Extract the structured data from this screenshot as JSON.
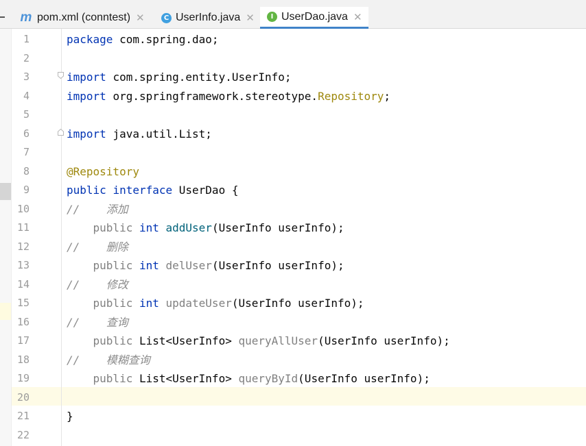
{
  "tabs": [
    {
      "label": "pom.xml (conntest)",
      "icon": "maven-icon",
      "icon_glyph": "m",
      "active": false
    },
    {
      "label": "UserInfo.java",
      "icon": "class-icon",
      "icon_glyph": "C",
      "active": false
    },
    {
      "label": "UserDao.java",
      "icon": "interface-icon",
      "icon_glyph": "I",
      "active": true
    }
  ],
  "close_glyph": "✕",
  "current_line": 20,
  "lines": [
    {
      "n": "1",
      "tokens": [
        {
          "t": "package ",
          "c": "kw"
        },
        {
          "t": "com.spring.dao;",
          "c": ""
        }
      ]
    },
    {
      "n": "2",
      "tokens": []
    },
    {
      "n": "3",
      "tokens": [
        {
          "t": "import ",
          "c": "kw"
        },
        {
          "t": "com.spring.entity.UserInfo;",
          "c": ""
        }
      ]
    },
    {
      "n": "4",
      "tokens": [
        {
          "t": "import ",
          "c": "kw"
        },
        {
          "t": "org.springframework.stereotype.",
          "c": ""
        },
        {
          "t": "Repository",
          "c": "type"
        },
        {
          "t": ";",
          "c": ""
        }
      ]
    },
    {
      "n": "5",
      "tokens": []
    },
    {
      "n": "6",
      "tokens": [
        {
          "t": "import ",
          "c": "kw"
        },
        {
          "t": "java.util.List;",
          "c": ""
        }
      ]
    },
    {
      "n": "7",
      "tokens": []
    },
    {
      "n": "8",
      "tokens": [
        {
          "t": "@Repository",
          "c": "ann"
        }
      ]
    },
    {
      "n": "9",
      "tokens": [
        {
          "t": "public ",
          "c": "kw"
        },
        {
          "t": "interface ",
          "c": "kw"
        },
        {
          "t": "UserDao {",
          "c": ""
        }
      ]
    },
    {
      "n": "10",
      "tokens": [
        {
          "t": "//    ",
          "c": "cm"
        },
        {
          "t": "添加",
          "c": "cm"
        }
      ]
    },
    {
      "n": "11",
      "tokens": [
        {
          "t": "    public ",
          "c": "kw2"
        },
        {
          "t": "int ",
          "c": "kw"
        },
        {
          "t": "addUser",
          "c": "fn"
        },
        {
          "t": "(UserInfo userInfo);",
          "c": ""
        }
      ]
    },
    {
      "n": "12",
      "tokens": [
        {
          "t": "//    ",
          "c": "cm"
        },
        {
          "t": "删除",
          "c": "cm"
        }
      ]
    },
    {
      "n": "13",
      "tokens": [
        {
          "t": "    public ",
          "c": "kw2"
        },
        {
          "t": "int ",
          "c": "kw"
        },
        {
          "t": "delUser",
          "c": "fn2"
        },
        {
          "t": "(UserInfo userInfo);",
          "c": ""
        }
      ]
    },
    {
      "n": "14",
      "tokens": [
        {
          "t": "//    ",
          "c": "cm"
        },
        {
          "t": "修改",
          "c": "cm"
        }
      ]
    },
    {
      "n": "15",
      "tokens": [
        {
          "t": "    public ",
          "c": "kw2"
        },
        {
          "t": "int ",
          "c": "kw"
        },
        {
          "t": "updateUser",
          "c": "fn2"
        },
        {
          "t": "(UserInfo userInfo);",
          "c": ""
        }
      ]
    },
    {
      "n": "16",
      "tokens": [
        {
          "t": "//    ",
          "c": "cm"
        },
        {
          "t": "查询",
          "c": "cm"
        }
      ]
    },
    {
      "n": "17",
      "tokens": [
        {
          "t": "    public ",
          "c": "kw2"
        },
        {
          "t": "List<UserInfo> ",
          "c": ""
        },
        {
          "t": "queryAllUser",
          "c": "fn2"
        },
        {
          "t": "(UserInfo userInfo);",
          "c": ""
        }
      ]
    },
    {
      "n": "18",
      "tokens": [
        {
          "t": "//    ",
          "c": "cm"
        },
        {
          "t": "模糊查询",
          "c": "cm"
        }
      ]
    },
    {
      "n": "19",
      "tokens": [
        {
          "t": "    public ",
          "c": "kw2"
        },
        {
          "t": "List<UserInfo> ",
          "c": ""
        },
        {
          "t": "queryById",
          "c": "fn2"
        },
        {
          "t": "(UserInfo userInfo);",
          "c": ""
        }
      ]
    },
    {
      "n": "20",
      "tokens": []
    },
    {
      "n": "21",
      "tokens": [
        {
          "t": "}",
          "c": ""
        }
      ]
    },
    {
      "n": "22",
      "tokens": []
    }
  ]
}
